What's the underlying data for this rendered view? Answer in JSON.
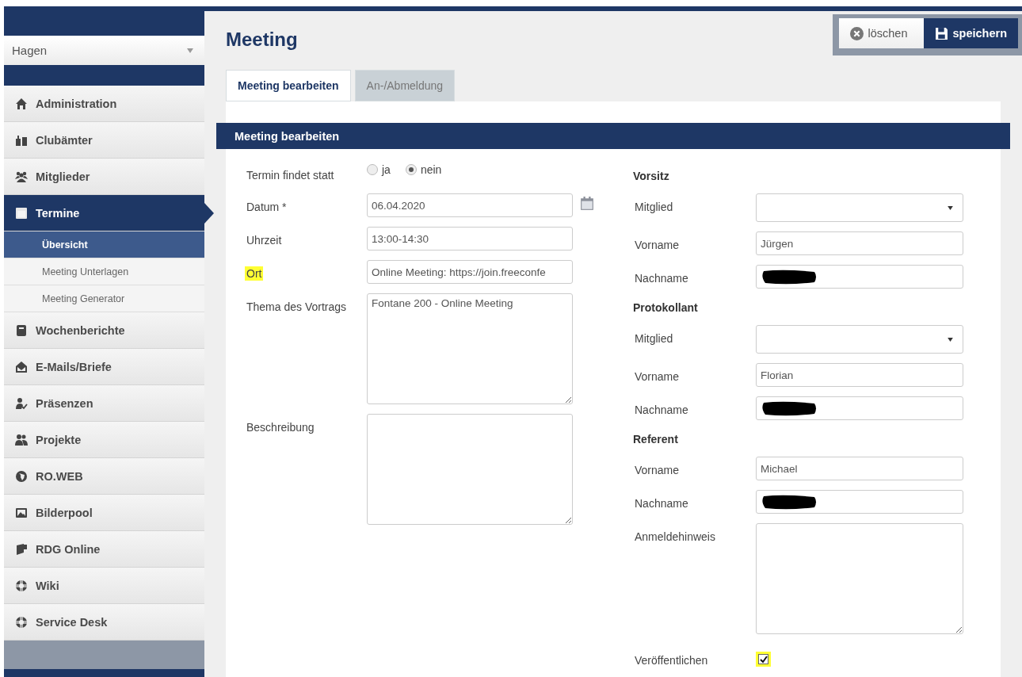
{
  "sidebar": {
    "club_select": "Hagen",
    "items": [
      {
        "label": "Administration",
        "selected": false
      },
      {
        "label": "Clubämter",
        "selected": false
      },
      {
        "label": "Mitglieder",
        "selected": false
      },
      {
        "label": "Termine",
        "selected": true,
        "children": [
          {
            "label": "Übersicht",
            "selected": true
          },
          {
            "label": "Meeting Unterlagen",
            "selected": false
          },
          {
            "label": "Meeting Generator",
            "selected": false
          }
        ]
      },
      {
        "label": "Wochenberichte",
        "selected": false
      },
      {
        "label": "E-Mails/Briefe",
        "selected": false
      },
      {
        "label": "Präsenzen",
        "selected": false
      },
      {
        "label": "Projekte",
        "selected": false
      },
      {
        "label": "RO.WEB",
        "selected": false
      },
      {
        "label": "Bilderpool",
        "selected": false
      },
      {
        "label": "RDG Online",
        "selected": false
      },
      {
        "label": "Wiki",
        "selected": false
      },
      {
        "label": "Service Desk",
        "selected": false
      }
    ]
  },
  "page": {
    "title": "Meeting",
    "actions": [
      {
        "label": "löschen",
        "kind": "delete"
      },
      {
        "label": "speichern",
        "kind": "save"
      }
    ]
  },
  "tabs": [
    {
      "label": "Meeting bearbeiten",
      "selected": true
    },
    {
      "label": "An-/Abmeldung",
      "selected": false
    }
  ],
  "section": {
    "title": "Meeting bearbeiten"
  },
  "form_left": [
    {
      "kind": "radio",
      "label": "Termin findet statt",
      "highlighted": false,
      "options": [
        {
          "label": "ja",
          "selected": false
        },
        {
          "label": "nein",
          "selected": true
        }
      ]
    },
    {
      "kind": "date",
      "label": "Datum *",
      "value": "06.04.2020",
      "highlighted": false
    },
    {
      "kind": "text",
      "label": "Uhrzeit",
      "value": "13:00-14:30",
      "highlighted": false
    },
    {
      "kind": "text",
      "label": "Ort",
      "value": "Online Meeting: https://join.freeconfe",
      "highlighted": true
    },
    {
      "kind": "textarea",
      "label": "Thema des Vortrags",
      "value": "Fontane 200 - Online Meeting",
      "highlighted": false
    },
    {
      "kind": "textarea",
      "label": "Beschreibung",
      "highlighted": false
    }
  ],
  "form_right": [
    {
      "kind": "heading",
      "label": "Vorsitz"
    },
    {
      "kind": "select",
      "label": "Mitglied"
    },
    {
      "kind": "text",
      "label": "Vorname",
      "value": "Jürgen",
      "redacted": false
    },
    {
      "kind": "text",
      "label": "Nachname",
      "redacted": true
    },
    {
      "kind": "heading",
      "label": "Protokollant"
    },
    {
      "kind": "select",
      "label": "Mitglied"
    },
    {
      "kind": "text",
      "label": "Vorname",
      "value": "Florian",
      "redacted": false
    },
    {
      "kind": "text",
      "label": "Nachname",
      "redacted": true
    },
    {
      "kind": "heading",
      "label": "Referent"
    },
    {
      "kind": "text",
      "label": "Vorname",
      "value": "Michael",
      "redacted": false
    },
    {
      "kind": "text",
      "label": "Nachname",
      "redacted": true
    },
    {
      "kind": "textarea",
      "label": "Anmeldehinweis"
    },
    {
      "kind": "checkbox",
      "label": "Veröffentlichen",
      "checked": true,
      "highlighted": true
    }
  ]
}
